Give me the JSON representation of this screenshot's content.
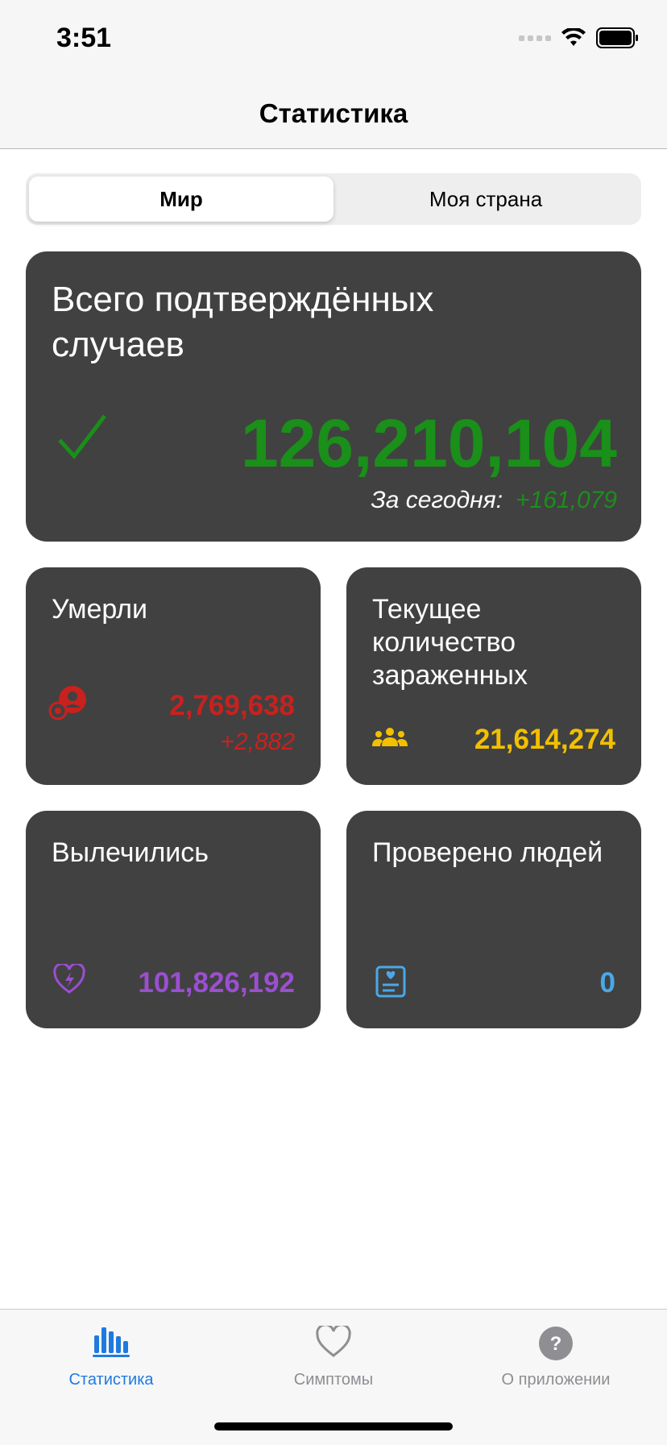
{
  "status_bar": {
    "time": "3:51"
  },
  "nav": {
    "title": "Статистика"
  },
  "segmented": {
    "left": "Мир",
    "right": "Моя страна"
  },
  "confirmed": {
    "title": "Всего подтверждённых случаев",
    "value": "126,210,104",
    "today_label": "За сегодня:",
    "today_value": "+161,079"
  },
  "deaths": {
    "title": "Умерли",
    "value": "2,769,638",
    "delta": "+2,882"
  },
  "active": {
    "title": "Текущее количество зараженных",
    "value": "21,614,274"
  },
  "recovered": {
    "title": "Вылечились",
    "value": "101,826,192"
  },
  "tested": {
    "title": "Проверено людей",
    "value": "0"
  },
  "tabs": [
    {
      "label": "Статистика"
    },
    {
      "label": "Симптомы"
    },
    {
      "label": "О приложении"
    }
  ],
  "colors": {
    "confirmed": "#1a8f1a",
    "deaths": "#c9211e",
    "active": "#f2c000",
    "recovered": "#9b4fd1",
    "tested": "#4aa8e8",
    "tab_active": "#1f7ae0"
  }
}
